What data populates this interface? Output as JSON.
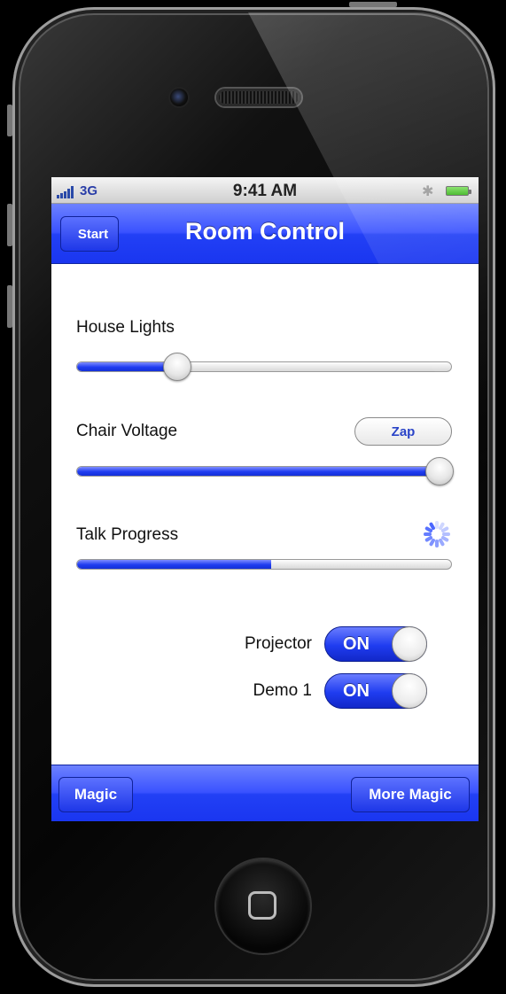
{
  "status_bar": {
    "carrier": "3G",
    "time": "9:41 AM",
    "bluetooth_icon": "bluetooth-icon",
    "battery_icon": "battery-icon",
    "signal_icon": "signal-bars-icon"
  },
  "nav": {
    "back_label": "Start",
    "title": "Room Control"
  },
  "controls": {
    "house_lights": {
      "label": "House Lights",
      "value": 0.27
    },
    "chair_voltage": {
      "label": "Chair Voltage",
      "value": 1.0,
      "button_label": "Zap"
    },
    "talk_progress": {
      "label": "Talk Progress",
      "value": 0.52,
      "spinner_icon": "activity-spinner-icon"
    },
    "switches": [
      {
        "label": "Projector",
        "state": "ON"
      },
      {
        "label": "Demo 1",
        "state": "ON"
      }
    ]
  },
  "toolbar": {
    "left_label": "Magic",
    "right_label": "More Magic"
  },
  "colors": {
    "accent_blue": "#1f3cf0",
    "nav_blue": "#3a52ff"
  }
}
